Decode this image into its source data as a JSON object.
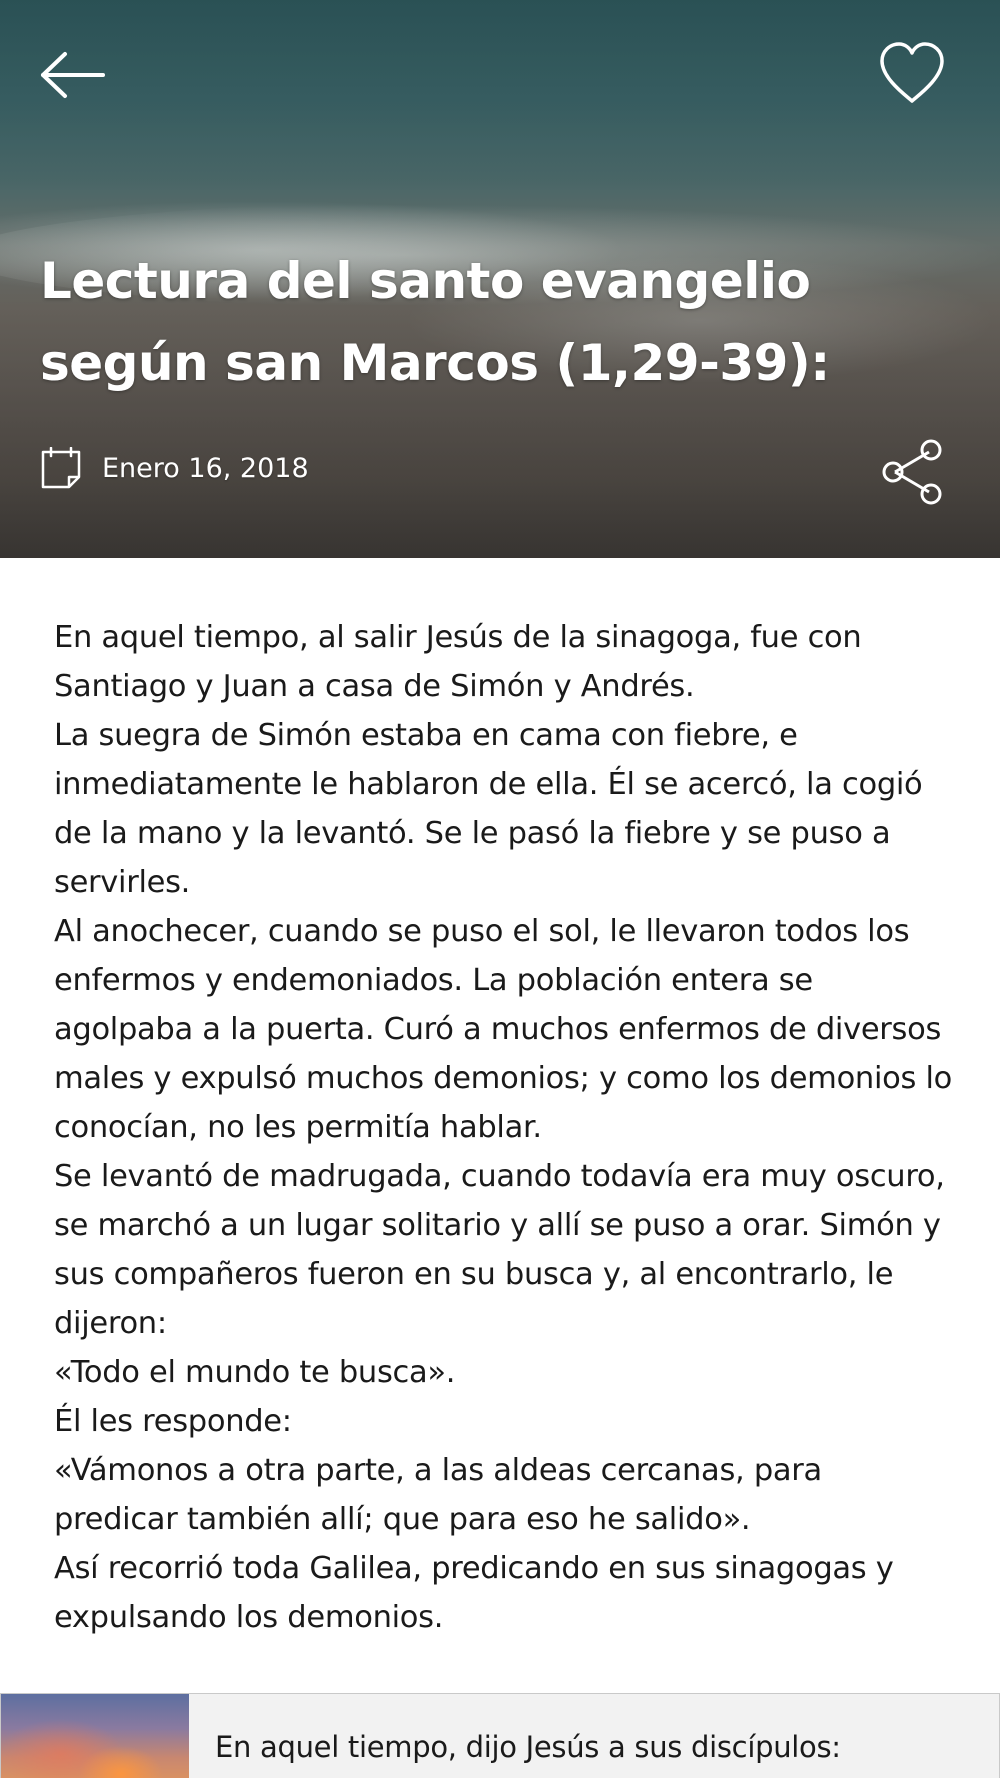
{
  "header": {
    "back_icon": "arrow-left-icon",
    "favorite_icon": "heart-outline-icon",
    "share_icon": "share-icon",
    "calendar_icon": "calendar-icon",
    "title_line1": "Lectura del santo evangelio",
    "title_line2": "según san Marcos (1,29-39):",
    "date": "Enero 16, 2018"
  },
  "reading": {
    "paragraphs": [
      "En aquel tiempo, al salir Jesús de la sinagoga, fue con Santiago y Juan a casa de Simón y Andrés.",
      "La suegra de Simón estaba en cama con fiebre, e inmediatamente le hablaron de ella. Él se acercó, la cogió de la mano y la levantó. Se le pasó la fiebre y se puso a servirles.",
      "Al anochecer, cuando se puso el sol, le llevaron todos los enfermos y endemoniados. La población entera se agolpaba a la puerta. Curó a muchos enfermos de diversos males y expulsó muchos demonios; y como los demonios lo conocían, no les permitía hablar.",
      "Se levantó de madrugada, cuando todavía era muy oscuro, se marchó a un lugar solitario y allí se puso a orar. Simón y sus compañeros fueron en su busca y, al encontrarlo, le dijeron:",
      "«Todo el mundo te busca».",
      "Él les responde:",
      "«Vámonos a otra parte, a las aldeas cercanas, para predicar también allí; que para eso he salido».",
      "Así recorrió toda Galilea, predicando en sus sinagogas y expulsando los demonios."
    ]
  },
  "next_card": {
    "preview_text": "En aquel tiempo, dijo Jesús a sus discípulos:"
  },
  "colors": {
    "hero_text": "#ffffff",
    "body_text": "#1a1a1a",
    "card_bg": "#f2f2f2"
  }
}
